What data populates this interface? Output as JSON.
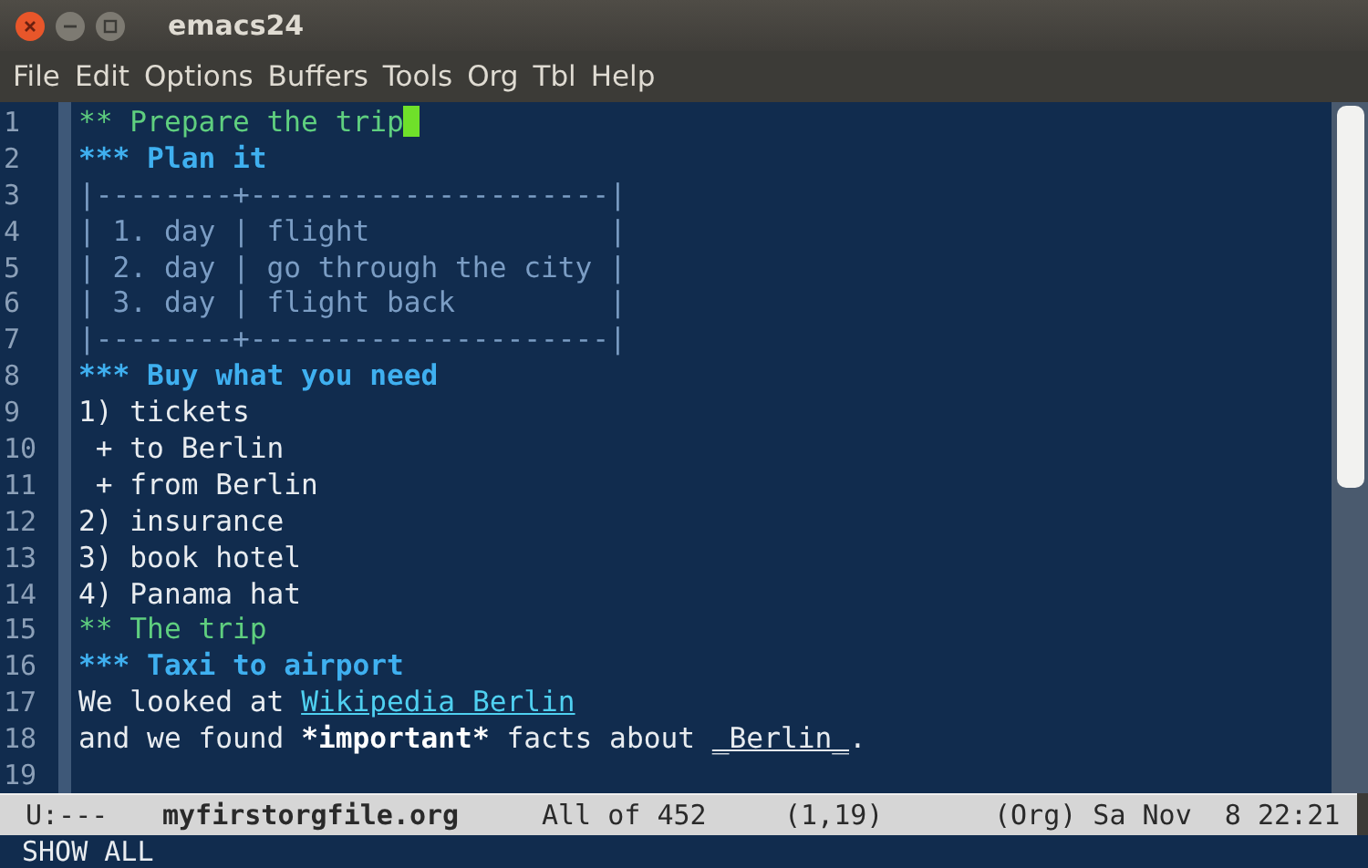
{
  "window": {
    "title": "emacs24"
  },
  "menu": [
    "File",
    "Edit",
    "Options",
    "Buffers",
    "Tools",
    "Org",
    "Tbl",
    "Help"
  ],
  "lines": [
    {
      "number": "1",
      "cursor": true,
      "segments": [
        {
          "kind": "h2",
          "text": "** Prepare the trip"
        }
      ]
    },
    {
      "number": "2",
      "cursor": false,
      "segments": [
        {
          "kind": "h3",
          "text": "*** Plan it"
        }
      ]
    },
    {
      "number": "3",
      "cursor": false,
      "segments": [
        {
          "kind": "table",
          "text": "|--------+---------------------|"
        }
      ]
    },
    {
      "number": "4",
      "cursor": false,
      "segments": [
        {
          "kind": "table",
          "text": "| 1. day | flight              |"
        }
      ]
    },
    {
      "number": "5",
      "cursor": false,
      "segments": [
        {
          "kind": "table",
          "text": "| 2. day | go through the city |"
        }
      ]
    },
    {
      "number": "6",
      "cursor": false,
      "segments": [
        {
          "kind": "table",
          "text": "| 3. day | flight back         |"
        }
      ]
    },
    {
      "number": "7",
      "cursor": false,
      "segments": [
        {
          "kind": "table",
          "text": "|--------+---------------------|"
        }
      ]
    },
    {
      "number": "8",
      "cursor": false,
      "segments": [
        {
          "kind": "h3",
          "text": "*** Buy what you need"
        }
      ]
    },
    {
      "number": "9",
      "cursor": false,
      "segments": [
        {
          "kind": "plain",
          "text": "1) tickets"
        }
      ]
    },
    {
      "number": "10",
      "cursor": false,
      "segments": [
        {
          "kind": "plain",
          "text": " + to Berlin"
        }
      ]
    },
    {
      "number": "11",
      "cursor": false,
      "segments": [
        {
          "kind": "plain",
          "text": " + from Berlin"
        }
      ]
    },
    {
      "number": "12",
      "cursor": false,
      "segments": [
        {
          "kind": "plain",
          "text": "2) insurance"
        }
      ]
    },
    {
      "number": "13",
      "cursor": false,
      "segments": [
        {
          "kind": "plain",
          "text": "3) book hotel"
        }
      ]
    },
    {
      "number": "14",
      "cursor": false,
      "segments": [
        {
          "kind": "plain",
          "text": "4) Panama hat"
        }
      ]
    },
    {
      "number": "15",
      "cursor": false,
      "segments": [
        {
          "kind": "h2",
          "text": "** The trip"
        }
      ]
    },
    {
      "number": "16",
      "cursor": false,
      "segments": [
        {
          "kind": "h3",
          "text": "*** Taxi to airport"
        }
      ]
    },
    {
      "number": "17",
      "cursor": false,
      "segments": [
        {
          "kind": "plain",
          "text": "We looked at "
        },
        {
          "kind": "link",
          "text": "Wikipedia Berlin"
        }
      ]
    },
    {
      "number": "18",
      "cursor": false,
      "segments": [
        {
          "kind": "plain",
          "text": "and we found "
        },
        {
          "kind": "bold",
          "text": "*important*"
        },
        {
          "kind": "plain",
          "text": " facts about "
        },
        {
          "kind": "underline",
          "text": "_Berlin_"
        },
        {
          "kind": "plain",
          "text": "."
        }
      ]
    },
    {
      "number": "19",
      "cursor": false
    }
  ],
  "mode_line": {
    "status": "U:---",
    "buffer": "myfirstorgfile.org",
    "position": "All of 452",
    "cursor_pos": "(1,19)",
    "modes": "(Org) Sa Nov  8 22:21"
  },
  "minibuffer": "SHOW ALL"
}
